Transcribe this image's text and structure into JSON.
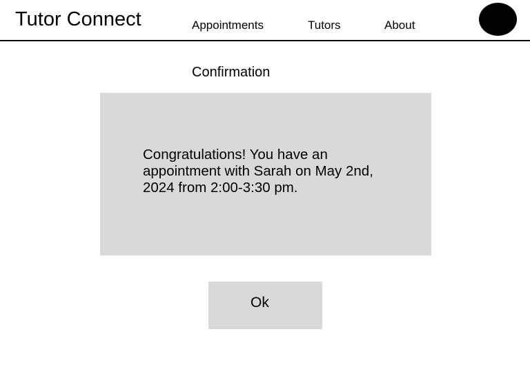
{
  "header": {
    "brand": "Tutor Connect",
    "nav": {
      "appointments": "Appointments",
      "tutors": "Tutors",
      "about": "About"
    }
  },
  "main": {
    "title": "Confirmation",
    "message": "Congratulations! You have an appointment with Sarah on May 2nd, 2024 from 2:00-3:30 pm.",
    "ok_label": "Ok"
  },
  "colors": {
    "background": "#ffffff",
    "panel": "#d9d9d9",
    "text": "#000000",
    "avatar": "#000000"
  }
}
